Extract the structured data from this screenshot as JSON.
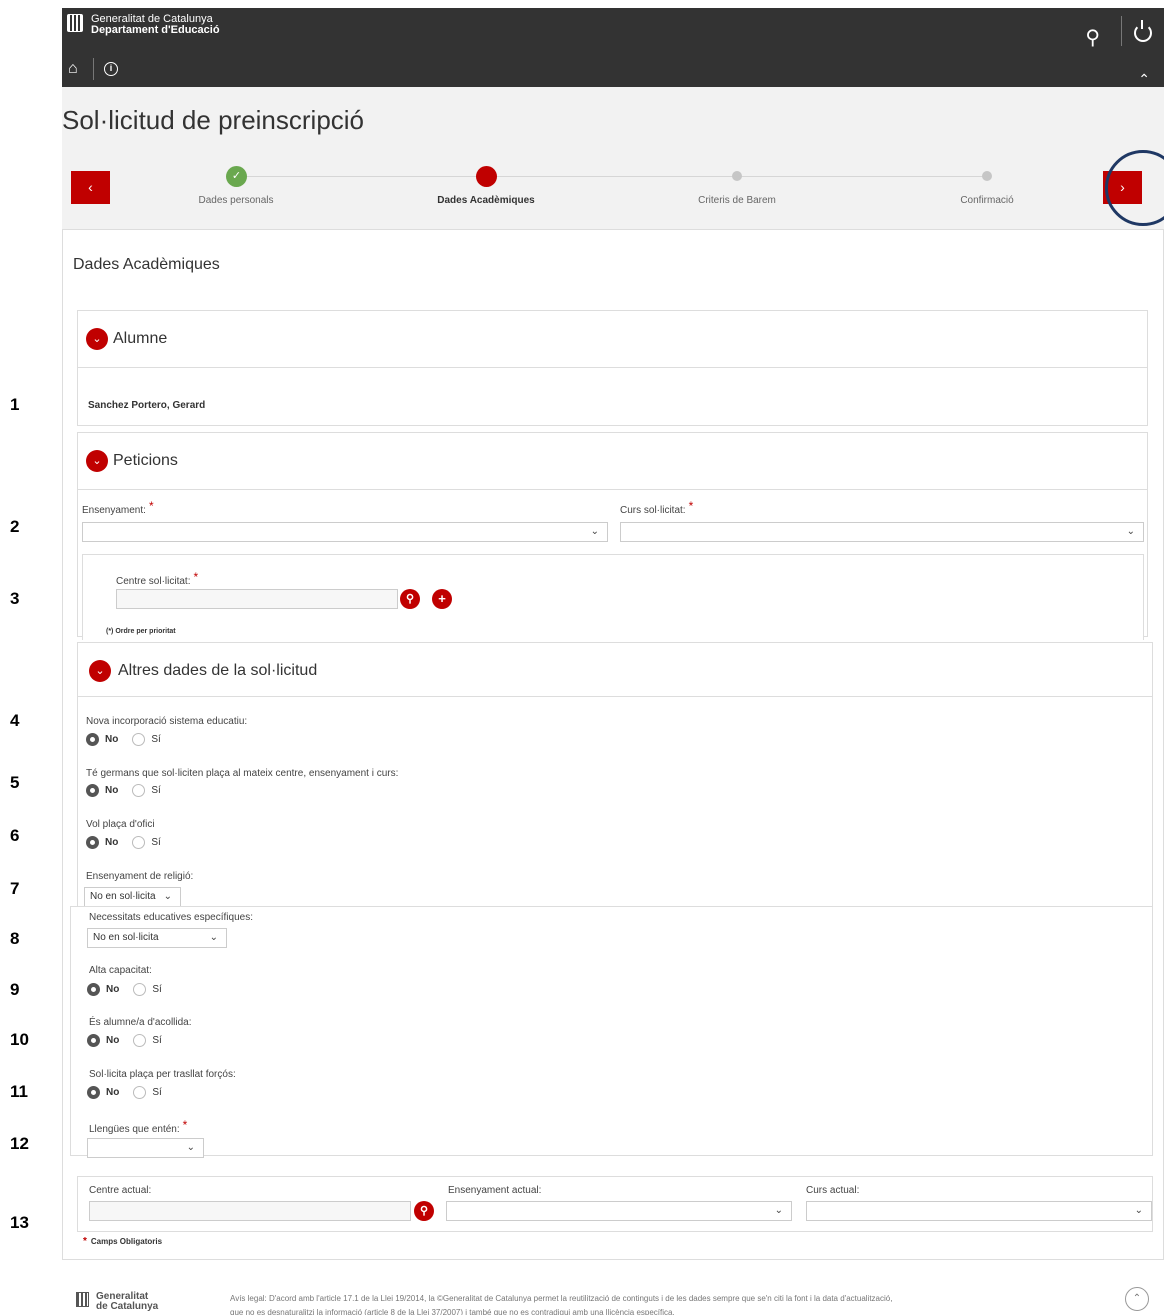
{
  "topbar": {
    "brand_line1": "Generalitat de Catalunya",
    "brand_line2": "Departament d'Educació",
    "user_icon": "user-icon",
    "power_icon": "power-icon",
    "home_icon": "home-icon",
    "info_icon": "info-icon"
  },
  "page": {
    "title": "Sol·licitud de preinscripció",
    "prev_label": "‹",
    "next_label": "›"
  },
  "steps": [
    {
      "label": "Dades personals",
      "state": "done"
    },
    {
      "label": "Dades Acadèmiques",
      "state": "active"
    },
    {
      "label": "Criteris de Barem",
      "state": "todo"
    },
    {
      "label": "Confirmació",
      "state": "todo"
    }
  ],
  "section": {
    "heading": "Dades Acadèmiques"
  },
  "alumne": {
    "title": "Alumne",
    "name": "Sanchez Portero, Gerard"
  },
  "peticions": {
    "title": "Peticions",
    "ensenyament_label": "Ensenyament:",
    "curs_label": "Curs sol·licitat:",
    "centre_label": "Centre sol·licitat:",
    "ordre_note": "(*) Ordre per prioritat",
    "required_mark": "*"
  },
  "altres": {
    "title": "Altres dades de la sol·licitud",
    "q_nova": "Nova incorporació sistema educatiu:",
    "q_germans": "Té germans que sol·liciten plaça al mateix centre, ensenyament i curs:",
    "q_ofici": "Vol plaça d'ofici",
    "q_religio": "Ensenyament de religió:",
    "religio_value": "No en sol·licita",
    "q_necessitats": "Necessitats educatives específiques:",
    "necessitats_value": "No en sol·licita",
    "q_alta": "Alta capacitat:",
    "q_acollida": "És alumne/a d'acollida:",
    "q_trasllat": "Sol·licita plaça per trasllat forçós:",
    "q_llengues": "Llengües que entén:",
    "radio_no": "No",
    "radio_si": "Sí"
  },
  "actual": {
    "centre_label": "Centre actual:",
    "ensenyament_label": "Ensenyament actual:",
    "curs_label": "Curs actual:"
  },
  "obligatoris": "Camps Obligatoris",
  "row_numbers": [
    "1",
    "2",
    "3",
    "4",
    "5",
    "6",
    "7",
    "8",
    "9",
    "10",
    "11",
    "12",
    "13"
  ],
  "footer": {
    "brand_line1": "Generalitat",
    "brand_line2": "de Catalunya",
    "legal_line1": "Avís legal: D'acord amb l'article 17.1 de la Llei 19/2014, la ©Generalitat de Catalunya permet la reutilització de continguts i de les dades sempre que se'n citi la font i la data d'actualització,",
    "legal_line2": "que no es desnaturalitzi la informació (article 8 de la Llei 37/2007) i també que no es contradigui amb una llicència específica."
  },
  "colors": {
    "accent": "#c00000",
    "done": "#6aa84f",
    "topbar": "#333333",
    "highlight": "#1f3864"
  }
}
